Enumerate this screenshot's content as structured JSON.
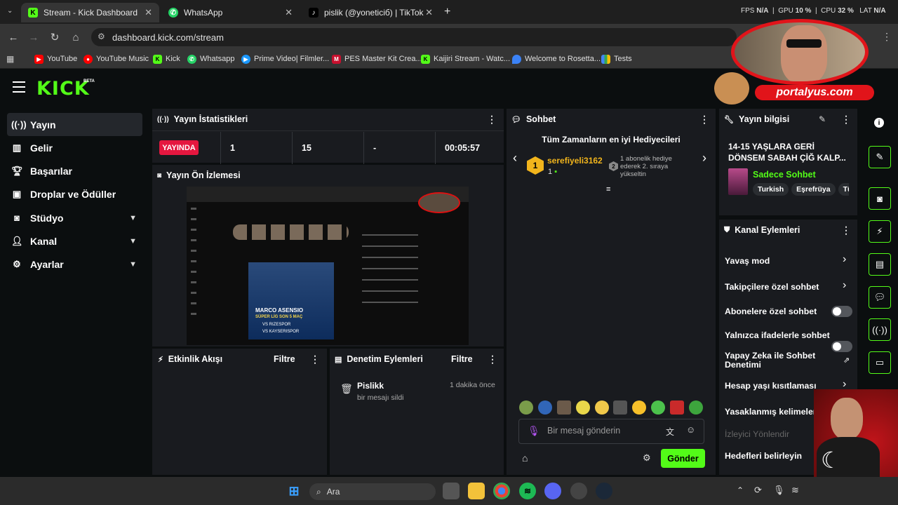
{
  "browser": {
    "tabs": [
      {
        "label": "Stream - Kick Dashboard"
      },
      {
        "label": "WhatsApp"
      },
      {
        "label": "pislik (@yoneticiб) | TikTok"
      }
    ],
    "url": "dashboard.kick.com/stream",
    "bookmarks": [
      "YouTube",
      "YouTube Music",
      "Kick",
      "Whatsapp",
      "Prime Video| Filmler...",
      "PES Master Kit Crea...",
      "Kaijiri Stream - Watc...",
      "Welcome to Rosetta...",
      "Tests"
    ],
    "overlay_stats": {
      "fps_label": "FPS",
      "fps": "N/A",
      "gpu_label": "GPU",
      "gpu": "10 %",
      "cpu_label": "CPU",
      "cpu": "32 %",
      "lat_label": "LAT",
      "lat": "N/A"
    },
    "webcam_brand": "portalyus.com"
  },
  "kick": {
    "logo": "KICK",
    "beta": "BETA",
    "sidebar": [
      {
        "label": "Yayın",
        "icon": "broadcast-icon"
      },
      {
        "label": "Gelir",
        "icon": "chart-icon"
      },
      {
        "label": "Başarılar",
        "icon": "trophy-icon"
      },
      {
        "label": "Droplar ve Ödüller",
        "icon": "gift-icon"
      },
      {
        "label": "Stüdyo",
        "icon": "studio-icon"
      },
      {
        "label": "Kanal",
        "icon": "user-icon"
      },
      {
        "label": "Ayarlar",
        "icon": "gear-icon"
      }
    ],
    "stats": {
      "title": "Yayın İstatistikleri",
      "live": "YAYINDA",
      "viewers": "1",
      "followers": "15",
      "subs": "-",
      "uptime": "00:05:57"
    },
    "preview": {
      "title": "Yayın Ön İzlemesi",
      "player": "MARCO ASENSIO",
      "subtitle": "SÜPER LİG SON 5 MAÇ",
      "match1": "VS RIZESPOR",
      "match2": "VS KAYSERISPOR"
    },
    "activity": {
      "title": "Etkinlik Akışı",
      "filter": "Filtre"
    },
    "moderation": {
      "title": "Denetim Eylemleri",
      "filter": "Filtre",
      "entry_user": "Pislikk",
      "entry_action": "bir mesajı sildi",
      "entry_time": "1 dakika önce"
    },
    "chat": {
      "title": "Sohbet",
      "leaderboard_title": "Tüm Zamanların en iyi Hediyecileri",
      "top_rank": "1",
      "top_user": "serefiyeli3162",
      "top_count": "1",
      "top_note": "1 abonelik hediye ederek 2. sıraya yükseltin",
      "next_rank": "2",
      "placeholder": "Bir mesaj gönderin",
      "send": "Gönder"
    },
    "stream_info": {
      "title": "Yayın bilgisi",
      "stream_title": "14-15 YAŞLARA GERİ DÖNSEM SABAH ÇİĞ KALP...",
      "category": "Sadece Sohbet",
      "tags": [
        "Turkish",
        "Eşrefrüya",
        "Tü"
      ]
    },
    "channel_actions": {
      "title": "Kanal Eylemleri",
      "items": [
        {
          "label": "Yavaş mod",
          "kind": "arrow"
        },
        {
          "label": "Takipçilere özel sohbet",
          "kind": "arrow"
        },
        {
          "label": "Abonelere özel sohbet",
          "kind": "toggle"
        },
        {
          "label": "Yalnızca ifadelerle sohbet",
          "kind": "toggle"
        },
        {
          "label": "Yapay Zeka ile Sohbet Denetimi",
          "kind": "external"
        },
        {
          "label": "Hesap yaşı kısıtlaması",
          "kind": "arrow"
        },
        {
          "label": "Yasaklanmış kelimeler",
          "kind": "none"
        },
        {
          "label": "İzleyici Yönlendir",
          "kind": "disabled"
        },
        {
          "label": "Hedefleri belirleyin",
          "kind": "none"
        }
      ]
    },
    "colors": {
      "accent": "#53fc18",
      "live": "#e5173f",
      "panel": "#191b1f"
    }
  },
  "taskbar": {
    "search": "Ara"
  }
}
